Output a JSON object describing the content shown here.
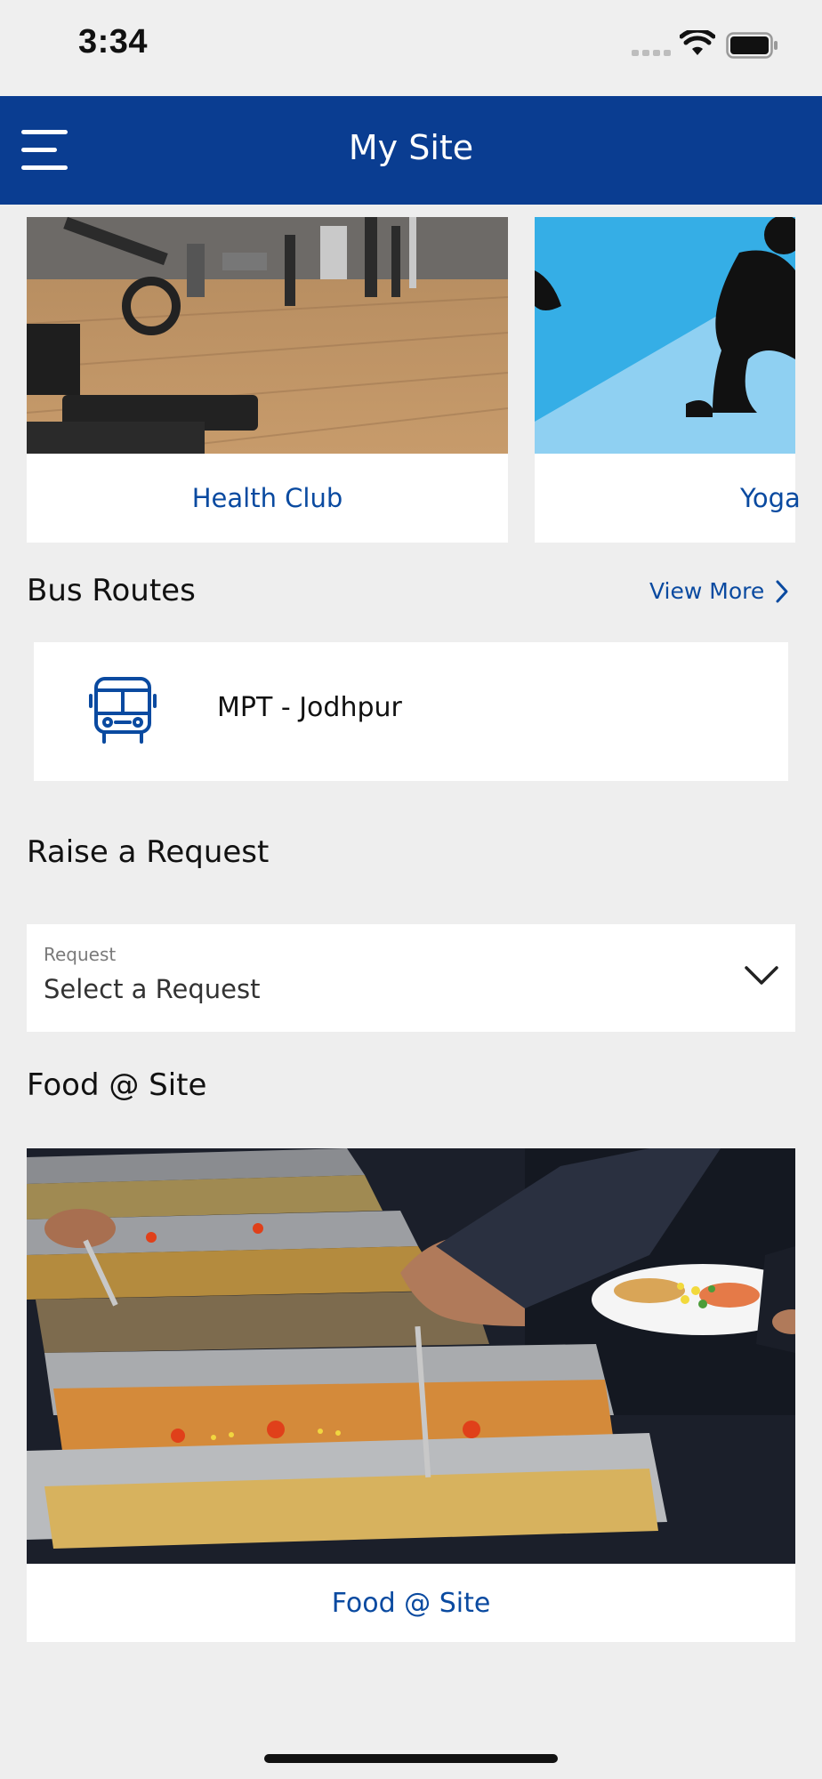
{
  "status_bar": {
    "time": "3:34",
    "signal_icon": "cellular-signal-icon",
    "wifi_icon": "wifi-icon",
    "battery_icon": "battery-full-icon"
  },
  "header": {
    "title": "My Site",
    "menu_icon": "hamburger-menu-icon",
    "background": "#0a3d91"
  },
  "facilities": {
    "items": [
      {
        "label": "Health Club",
        "image": "gym-equipment-photo"
      },
      {
        "label": "Yoga",
        "image": "yoga-silhouette-illustration"
      }
    ]
  },
  "bus_routes": {
    "title": "Bus Routes",
    "view_more_label": "View More",
    "routes": [
      {
        "name": "MPT - Jodhpur",
        "icon": "bus-icon"
      }
    ]
  },
  "raise_request": {
    "title": "Raise a Request",
    "field_label": "Request",
    "selected_value": "Select a Request"
  },
  "food": {
    "title": "Food @ Site",
    "card_label": "Food @ Site",
    "image": "buffet-food-photo"
  },
  "colors": {
    "accent": "#0a4aa0",
    "background": "#eeeeee"
  }
}
